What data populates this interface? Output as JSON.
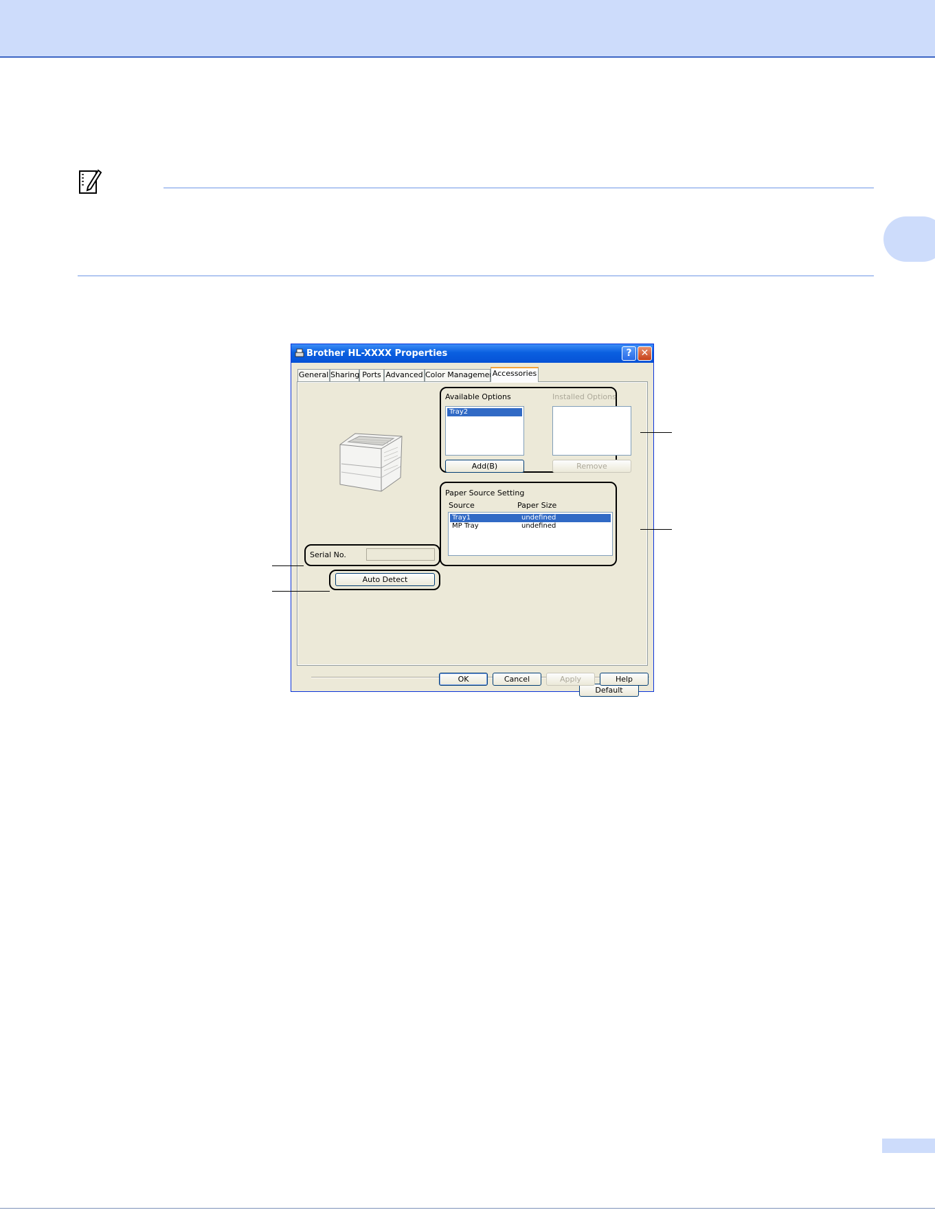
{
  "dialog": {
    "title": "Brother HL-XXXX Properties",
    "help_glyph": "?",
    "close_glyph": "✕",
    "tabs": [
      {
        "label": "General"
      },
      {
        "label": "Sharing"
      },
      {
        "label": "Ports"
      },
      {
        "label": "Advanced"
      },
      {
        "label": "Color Management"
      },
      {
        "label": "Accessories"
      }
    ],
    "active_tab": "Accessories",
    "available_options": {
      "label": "Available Options",
      "items": [
        "Tray2"
      ],
      "selected": "Tray2"
    },
    "installed_options": {
      "label": "Installed Options",
      "items": []
    },
    "add_button": "Add(B)",
    "remove_button": "Remove",
    "paper_source": {
      "label": "Paper Source Setting",
      "columns": [
        "Source",
        "Paper Size"
      ],
      "rows": [
        {
          "source": "Tray1",
          "size": "undefined"
        },
        {
          "source": "MP Tray",
          "size": "undefined"
        }
      ],
      "selected_row": 0
    },
    "serial": {
      "label": "Serial No.",
      "value": ""
    },
    "auto_detect_button": "Auto Detect",
    "default_button": "Default",
    "ok_button": "OK",
    "cancel_button": "Cancel",
    "apply_button": "Apply",
    "help_button": "Help"
  },
  "colors": {
    "header_band": "#cddcfb",
    "rule": "#6e96e6",
    "xp_title_blue": "#0a5fe0",
    "selection": "#316ac5"
  }
}
